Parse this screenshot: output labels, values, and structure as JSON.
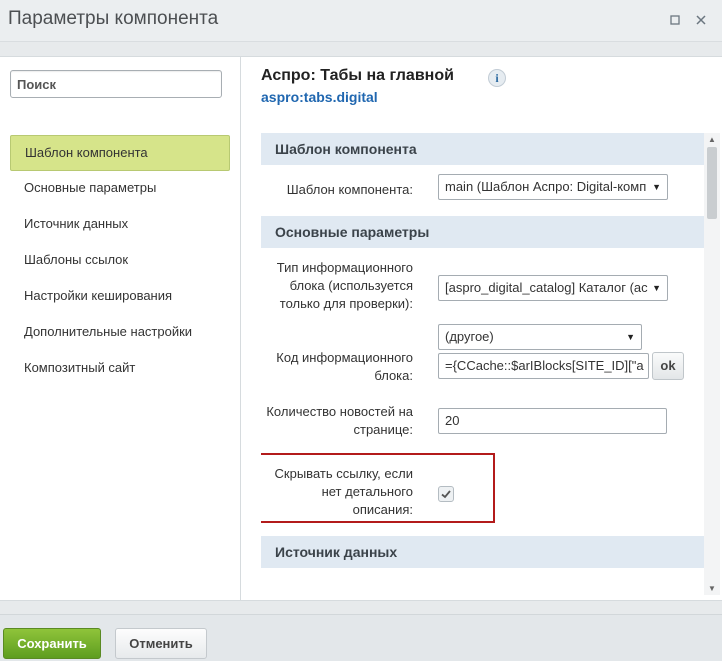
{
  "window": {
    "title": "Параметры компонента"
  },
  "search": {
    "placeholder": "Поиск"
  },
  "sidebar": {
    "items": [
      {
        "label": "Шаблон компонента",
        "active": true
      },
      {
        "label": "Основные параметры",
        "active": false
      },
      {
        "label": "Источник данных",
        "active": false
      },
      {
        "label": "Шаблоны ссылок",
        "active": false
      },
      {
        "label": "Настройки кеширования",
        "active": false
      },
      {
        "label": "Дополнительные настройки",
        "active": false
      },
      {
        "label": "Композитный сайт",
        "active": false
      }
    ]
  },
  "component": {
    "title": "Аспро: Табы на главной",
    "info_icon": "i",
    "code": "aspro:tabs.digital"
  },
  "sections": {
    "template": "Шаблон компонента",
    "basic": "Основные параметры",
    "source": "Источник данных"
  },
  "fields": {
    "template": {
      "label": "Шаблон компонента:",
      "value": "main (Шаблон Аспро: Digital-комп"
    },
    "iblock_type": {
      "label_line1": "Тип информационного",
      "label_line2": "блока (используется",
      "label_line3": "только для проверки):",
      "value": "[aspro_digital_catalog] Каталог (ас"
    },
    "iblock_code": {
      "label_line1": "Код информационного",
      "label_line2": "блока:",
      "select_value": "(другое)",
      "input_value": "={CCache::$arIBlocks[SITE_ID][\"a",
      "ok_label": "ok"
    },
    "news_count": {
      "label_line1": "Количество новостей на",
      "label_line2": "странице:",
      "value": "20"
    },
    "hide_link": {
      "label_line1": "Скрывать ссылку, если",
      "label_line2": "нет детального",
      "label_line3": "описания:",
      "checked": true
    }
  },
  "footer": {
    "save_label": "Сохранить",
    "cancel_label": "Отменить"
  },
  "colors": {
    "accent_green": "#6aa82a",
    "active_nav": "#d6e48a",
    "link_blue": "#2067b0",
    "highlight_red": "#b31b1b",
    "section_bg": "#e0e9f2"
  },
  "icons": {
    "maximize": "maximize-icon",
    "close": "close-icon",
    "info": "info-icon",
    "dropdown": "chevron-down-icon",
    "check": "check-icon"
  }
}
